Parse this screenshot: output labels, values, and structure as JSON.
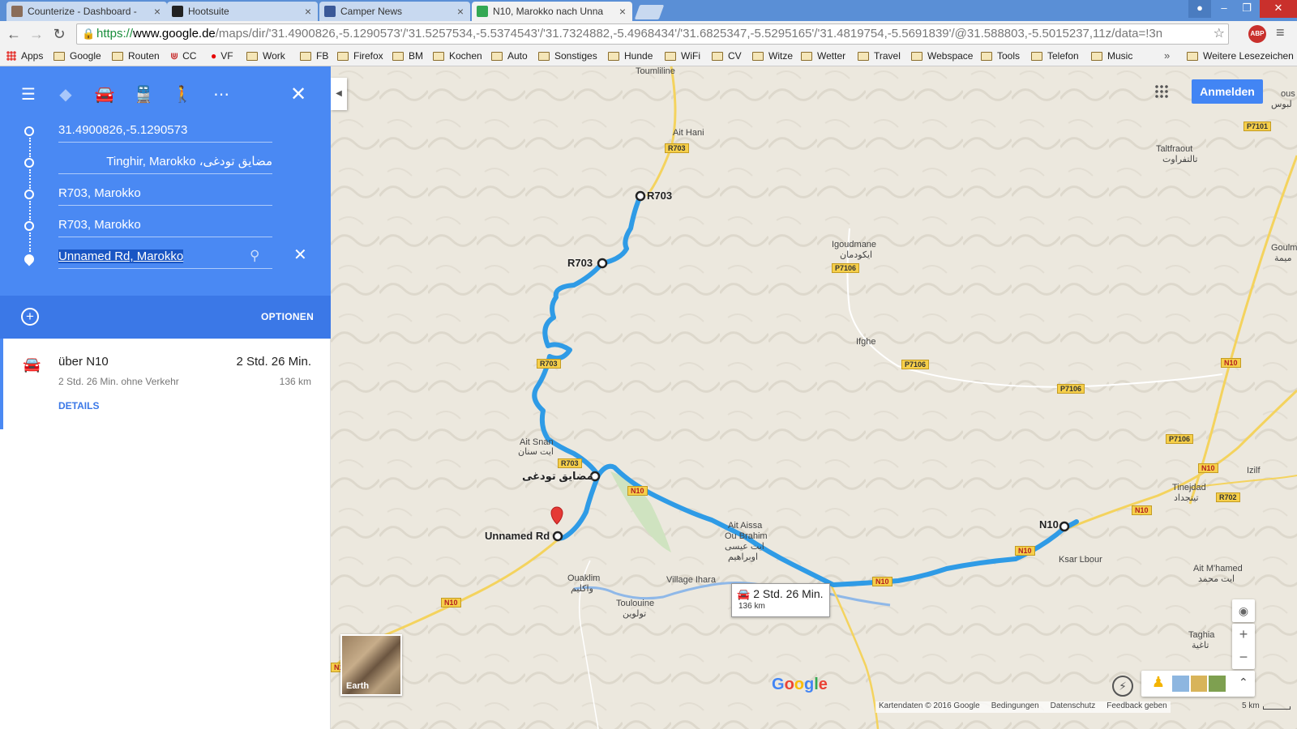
{
  "browser": {
    "tabs": [
      {
        "title": "Counterize - Dashboard -",
        "color": "#8a6d5a"
      },
      {
        "title": "Hootsuite",
        "color": "#222222"
      },
      {
        "title": "Camper News",
        "color": "#3b5998"
      },
      {
        "title": "N10, Marokko nach Unna",
        "color": "#34a853"
      }
    ],
    "url": {
      "scheme": "https://",
      "host": "www.google.de",
      "path": "/maps/dir/'31.4900826,-5.1290573'/'31.5257534,-5.5374543'/'31.7324882,-5.4968434'/'31.6825347,-5.5295165'/'31.4819754,-5.5691839'/@31.588803,-5.5015237,11z/data=!3n"
    },
    "abp_label": "ABP",
    "bookmarks": [
      {
        "label": "Apps",
        "icon": "apps-grid-icon"
      },
      {
        "label": "Google",
        "icon": "folder-icon"
      },
      {
        "label": "Routen",
        "icon": "folder-icon"
      },
      {
        "label": "CC",
        "icon": "cc-icon"
      },
      {
        "label": "VF",
        "icon": "vodafone-icon"
      },
      {
        "label": "Work",
        "icon": "folder-icon"
      },
      {
        "label": "FB",
        "icon": "folder-icon"
      },
      {
        "label": "Firefox",
        "icon": "folder-icon"
      },
      {
        "label": "BM",
        "icon": "folder-icon"
      },
      {
        "label": "Kochen",
        "icon": "folder-icon"
      },
      {
        "label": "Auto",
        "icon": "folder-icon"
      },
      {
        "label": "Sonstiges",
        "icon": "folder-icon"
      },
      {
        "label": "Hunde",
        "icon": "folder-icon"
      },
      {
        "label": "WiFi",
        "icon": "folder-icon"
      },
      {
        "label": "CV",
        "icon": "folder-icon"
      },
      {
        "label": "Witze",
        "icon": "folder-icon"
      },
      {
        "label": "Wetter",
        "icon": "folder-icon"
      },
      {
        "label": "Travel",
        "icon": "folder-icon"
      },
      {
        "label": "Webspace",
        "icon": "folder-icon"
      },
      {
        "label": "Tools",
        "icon": "folder-icon"
      },
      {
        "label": "Telefon",
        "icon": "folder-icon"
      },
      {
        "label": "Music",
        "icon": "folder-icon"
      }
    ],
    "bookmarks_more": "»",
    "bookmarks_other": "Weitere Lesezeichen"
  },
  "panel": {
    "accent": "#4a89f3",
    "waypoints": [
      {
        "text": "31.4900826,-5.1290573"
      },
      {
        "text": "Tinghir, Marokko ،مضايق تودغى"
      },
      {
        "text": "R703, Marokko"
      },
      {
        "text": "R703, Marokko"
      },
      {
        "text": "Unnamed Rd, Marokko"
      }
    ],
    "options_label": "OPTIONEN",
    "route": {
      "via": "über N10",
      "time": "2 Std. 26 Min.",
      "subtitle": "2 Std. 26 Min. ohne Verkehr",
      "distance": "136 km",
      "details_label": "DETAILS"
    }
  },
  "map": {
    "route_color": "#2f9be6",
    "signin_label": "Anmelden",
    "time_box": {
      "time": "2 Std. 26 Min.",
      "distance": "136 km"
    },
    "earth_label": "Earth",
    "footer": [
      "Kartendaten © 2016 Google",
      "Bedingungen",
      "Datenschutz",
      "Feedback geben"
    ],
    "scale_label": "5 km",
    "labels": {
      "toumliline": "Toumliline",
      "ait_hani": "Ait Hani",
      "taltfraout": "Taltfraout",
      "taltfraout_ar": "تالتفراوت",
      "igoudmane": "Igoudmane",
      "igoudmane_ar": "ايكودمان",
      "ifghe": "Ifghe",
      "ait_snan": "Ait Snan",
      "ait_snan_ar": "ايت سنان",
      "ait_aissa": "Ait Aissa",
      "ou_brahim": "Ou Brahim",
      "ait_aissa_ar": "ايت عيسى",
      "ait_aissa_ar2": "اوبراهيم",
      "ouaklim": "Ouaklim",
      "ouaklim_ar": "واكليم",
      "village_ihara": "Village Ihara",
      "toulouine": "Toulouine",
      "toulouine_ar": "تولوين",
      "tinejdad": "Tinejdad",
      "tinejdad_ar": "تينجداد",
      "izilf": "Izilf",
      "ksar_lbour": "Ksar Lbour",
      "ait_mhamed": "Ait M'hamed",
      "ait_mhamed_ar": "ايت محمد",
      "taghia": "Taghia",
      "taghia_ar": "تاغية",
      "goulmima": "Goulm",
      "goulmima_ar": "ميمة",
      "top_right": "ous",
      "top_right_ar": "لبوس",
      "wp_r703_a": "R703",
      "wp_r703_b": "R703",
      "wp_n10": "N10",
      "wp_gorges": "مضايق تودغى",
      "wp_unnamed": "Unnamed Rd"
    },
    "shields": {
      "r703_1": "R703",
      "r703_2": "R703",
      "r703_3": "R703",
      "p7106_1": "P7106",
      "p7106_2": "P7106",
      "p7106_3": "P7106",
      "p7106_4": "P7106",
      "p7101": "P7101",
      "r702": "R702",
      "n10_1": "N10",
      "n10_2": "N10",
      "n10_3": "N10",
      "n10_4": "N10",
      "n10_5": "N10",
      "n10_6": "N10",
      "n10_7": "N10",
      "n10_8": "N10"
    }
  }
}
